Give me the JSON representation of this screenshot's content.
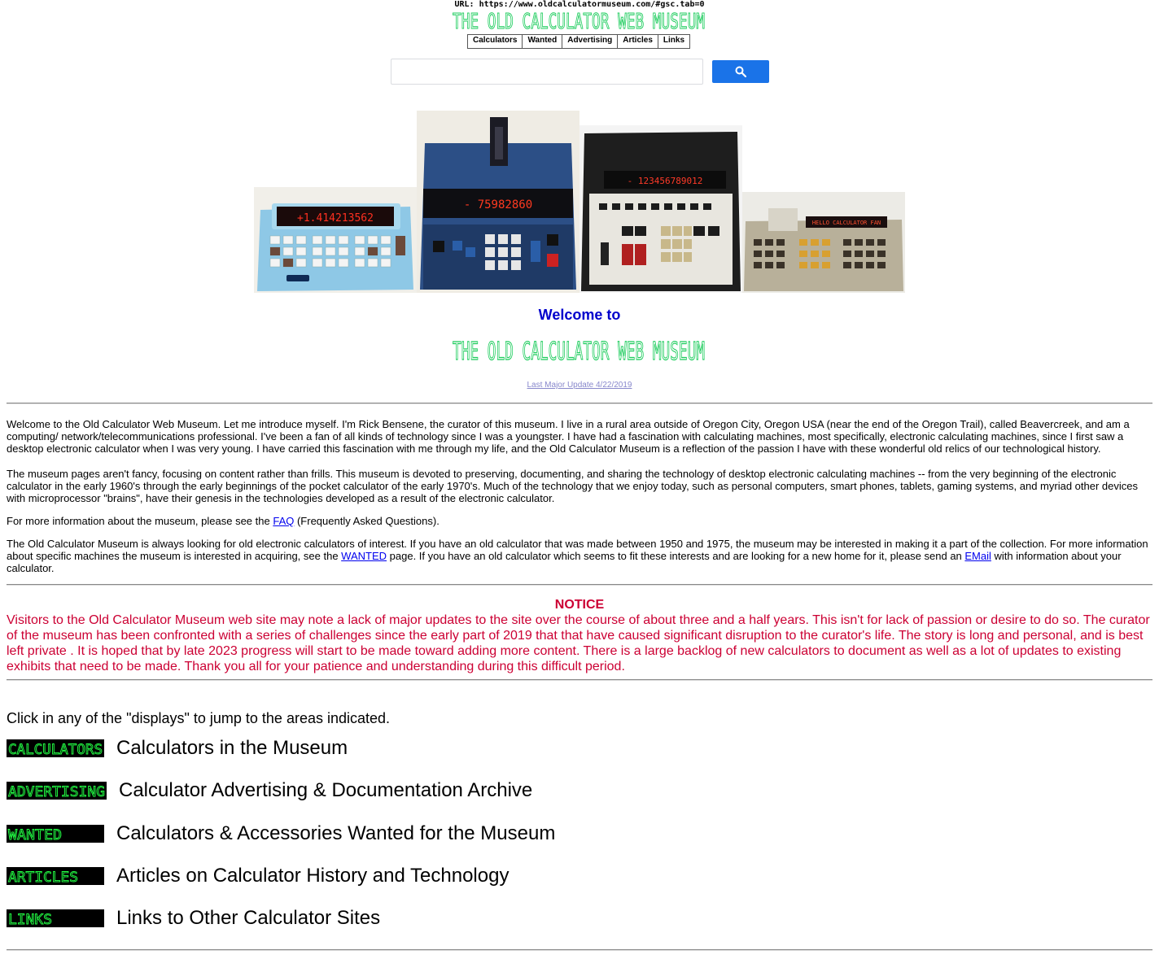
{
  "header": {
    "url_line": "URL: https://www.oldcalculatormuseum.com/#gsc.tab=0",
    "banner_text": "THE OLD CALCULATOR WEB MUSEUM",
    "nav": [
      "Calculators",
      "Wanted",
      "Advertising",
      "Articles",
      "Links"
    ]
  },
  "search": {
    "placeholder": "",
    "button_icon": "search-icon"
  },
  "colors": {
    "lcd_green": "#22ff44",
    "welcome_blue": "#0000cc",
    "notice_red": "#cc0033",
    "search_blue": "#1a73e8"
  },
  "welcome": {
    "heading": "Welcome to",
    "banner_text": "THE OLD CALCULATOR WEB MUSEUM",
    "last_update": "Last Major Update 4/22/2019"
  },
  "intro": {
    "p1": "Welcome to the Old Calculator Web Museum. Let me introduce myself. I'm Rick Bensene, the curator of this museum. I live in a rural area outside of Oregon City, Oregon USA (near the end of the Oregon Trail), called Beavercreek, and am a computing/ network/telecommunications professional. I've been a fan of all kinds of technology since I was a youngster. I have had a fascination with calculating machines, most specifically, electronic calculating machines, since I first saw a desktop electronic calculator when I was very young. I have carried this fascination with me through my life, and the Old Calculator Museum is a reflection of the passion I have with these wonderful old relics of our technological history.",
    "p2": "The museum pages aren't fancy, focusing on content rather than frills. This museum is devoted to preserving, documenting, and sharing the technology of desktop electronic calculating machines -- from the very beginning of the electronic calculator in the early 1960's through the early beginnings of the pocket calculator of the early 1970's. Much of the technology that we enjoy today, such as personal computers, smart phones, tablets, gaming systems, and myriad other devices with microprocessor \"brains\", have their genesis in the technologies developed as a result of the electronic calculator.",
    "p3_before": "For more information about the museum, please see the ",
    "p3_link": "FAQ",
    "p3_after": " (Frequently Asked Questions).",
    "p4_a": "The Old Calculator Museum is always looking for old electronic calculators of interest. If you have an old calculator that was made between 1950 and 1975, the museum may be interested in making it a part of the collection. For more information about specific machines the museum is interested in acquiring, see the ",
    "p4_link1": "WANTED",
    "p4_b": " page. If you have an old calculator which seems to fit these interests and are looking for a new home for it, please send an ",
    "p4_link2": "EMail",
    "p4_c": " with information about your calculator."
  },
  "notice": {
    "title": "NOTICE",
    "body": "Visitors to the Old Calculator Museum web site may note a lack of major updates to the site over the course of about three and a half years. This isn't for lack of passion or desire to do so. The curator of the museum has been confronted with a series of challenges since the early part of 2019 that that have caused significant disruption to the curator's life. The story is long and personal, and is best left private . It is hoped that by late 2023 progress will start to be made toward adding more content. There is a large backlog of new calculators to document as well as a lot of updates to existing exhibits that need to be made. Thank you all for your patience and understanding during this difficult period."
  },
  "sections": {
    "intro_text": "Click in any of the \"displays\" to jump to the areas indicated.",
    "items": [
      {
        "display": "CALCULATORS",
        "label": "Calculators in the Museum"
      },
      {
        "display": "ADVERTISING",
        "label": "Calculator Advertising & Documentation Archive"
      },
      {
        "display": "WANTED",
        "label": "Calculators & Accessories Wanted for the Museum"
      },
      {
        "display": "ARTICLES",
        "label": "Articles on Calculator History and Technology"
      },
      {
        "display": "LINKS",
        "label": "Links to Other Calculator Sites"
      }
    ]
  },
  "photos": {
    "photo1_display": "+1.414213562",
    "photo2_display": "- 75982860",
    "photo3_display": "- 123456789012",
    "photo4_display": "HELLO CALCULATOR FAN"
  }
}
